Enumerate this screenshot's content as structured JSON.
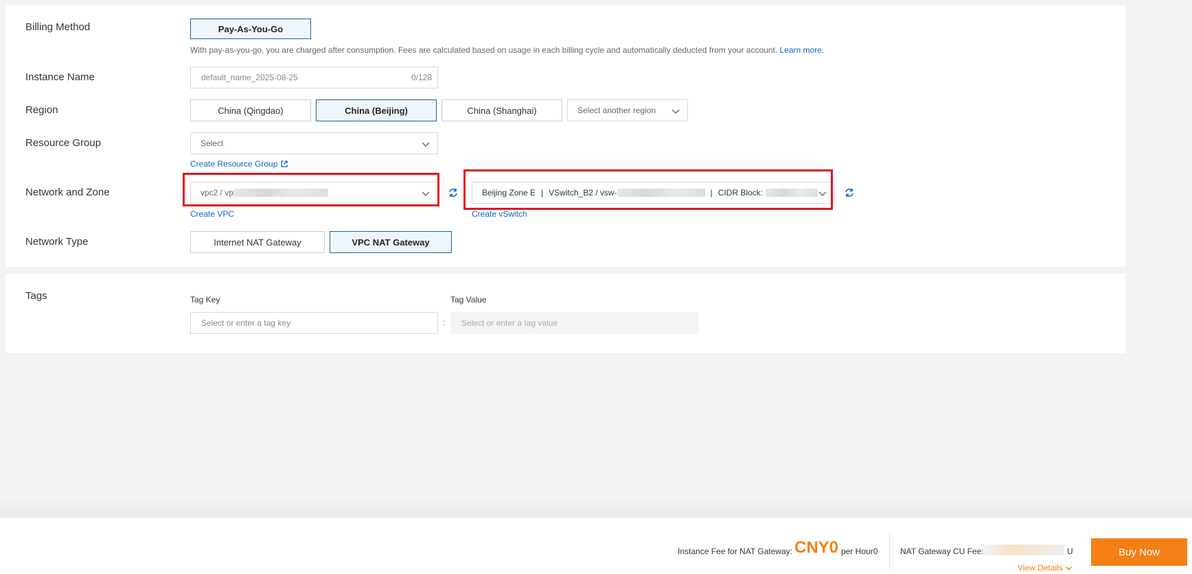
{
  "billing": {
    "label": "Billing Method",
    "option": "Pay-As-You-Go",
    "hint": "With pay-as-you-go, you are charged after consumption. Fees are calculated based on usage in each billing cycle and automatically deducted from your account.",
    "learn_more": "Learn more."
  },
  "instance_name": {
    "label": "Instance Name",
    "value": "default_name_2025-08-25",
    "counter": "0/128"
  },
  "region": {
    "label": "Region",
    "options": [
      "China (Qingdao)",
      "China (Beijing)",
      "China (Shanghai)"
    ],
    "selected": "China (Beijing)",
    "other_placeholder": "Select another region"
  },
  "resource_group": {
    "label": "Resource Group",
    "placeholder": "Select",
    "create_link": "Create Resource Group"
  },
  "network_zone": {
    "label": "Network and Zone",
    "vpc_value": "vpc2 / vp",
    "create_vpc": "Create VPC",
    "vswitch_zone": "Beijing Zone E",
    "vswitch_sep": "|",
    "vswitch_name": "VSwitch_B2 / vsw-",
    "cidr_label": "CIDR Block:",
    "create_vswitch": "Create vSwitch"
  },
  "network_type": {
    "label": "Network Type",
    "options": [
      "Internet NAT Gateway",
      "VPC NAT Gateway"
    ],
    "selected": "VPC NAT Gateway"
  },
  "tags": {
    "label": "Tags",
    "key_caption": "Tag Key",
    "value_caption": "Tag Value",
    "key_placeholder": "Select or enter a tag key",
    "value_placeholder": "Select or enter a tag value",
    "separator": ":"
  },
  "footer": {
    "instance_fee_label": "Instance Fee for NAT Gateway:",
    "instance_fee_price": "CNY0",
    "instance_fee_unit": "per Hour0",
    "cu_fee_label": "NAT Gateway CU Fee:",
    "cu_fee_suffix": "U",
    "view_details": "View Details",
    "buy_now": "Buy Now"
  },
  "colors": {
    "accent": "#f57f17",
    "link": "#0b66c2",
    "highlight_frame": "#e0141e",
    "selected_border": "#1f5f9e"
  }
}
